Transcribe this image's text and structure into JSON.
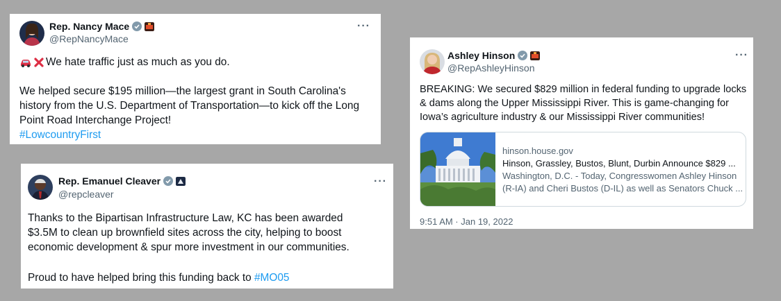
{
  "tweets": [
    {
      "name": "Rep. Nancy Mace",
      "handle": "@RepNancyMace",
      "line1_text": "We hate traffic just as much as you do.",
      "line1_icons": [
        "car-emoji",
        "red-x-emoji"
      ],
      "body_lines": [
        "We helped secure $195 million—the largest grant in South Carolina's",
        "history from the U.S. Department of Transportation—to kick off the Long",
        "Point Road Interchange Project!"
      ],
      "hashtag": "#LowcountryFirst",
      "affiliation_badge": "us-capitol-badge-icon"
    },
    {
      "name": "Rep. Emanuel Cleaver",
      "handle": "@repcleaver",
      "body_lines": [
        "Thanks to the Bipartisan Infrastructure Law, KC has been awarded",
        "$3.5M to clean up brownfield sites across the city, helping to boost",
        "economic development & spur more investment in our communities."
      ],
      "closing_text": "Proud to have helped bring this funding back to ",
      "hashtag": "#MO05",
      "affiliation_badge": "us-capitol-badge-icon"
    },
    {
      "name": "Ashley Hinson",
      "handle": "@RepAshleyHinson",
      "body_lines": [
        "BREAKING: We secured $829 million in federal funding to upgrade locks",
        "& dams along the Upper Mississippi River. This is game-changing for",
        "Iowa’s agriculture industry & our Mississippi River communities!"
      ],
      "link_card": {
        "domain": "hinson.house.gov",
        "title": "Hinson, Grassley, Bustos, Blunt, Durbin Announce $829 ...",
        "desc_line1": "Washington, D.C. - Today, Congresswomen Ashley Hinson",
        "desc_line2": "(R-IA) and Cheri Bustos (D-IL) as well as Senators Chuck ..."
      },
      "timestamp": "9:51 AM · Jan 19, 2022",
      "affiliation_badge": "us-capitol-badge-icon"
    }
  ],
  "more_label": "···",
  "colors": {
    "link": "#1d9bf0",
    "verified": "#829aab",
    "background": "#a7a7a7"
  }
}
